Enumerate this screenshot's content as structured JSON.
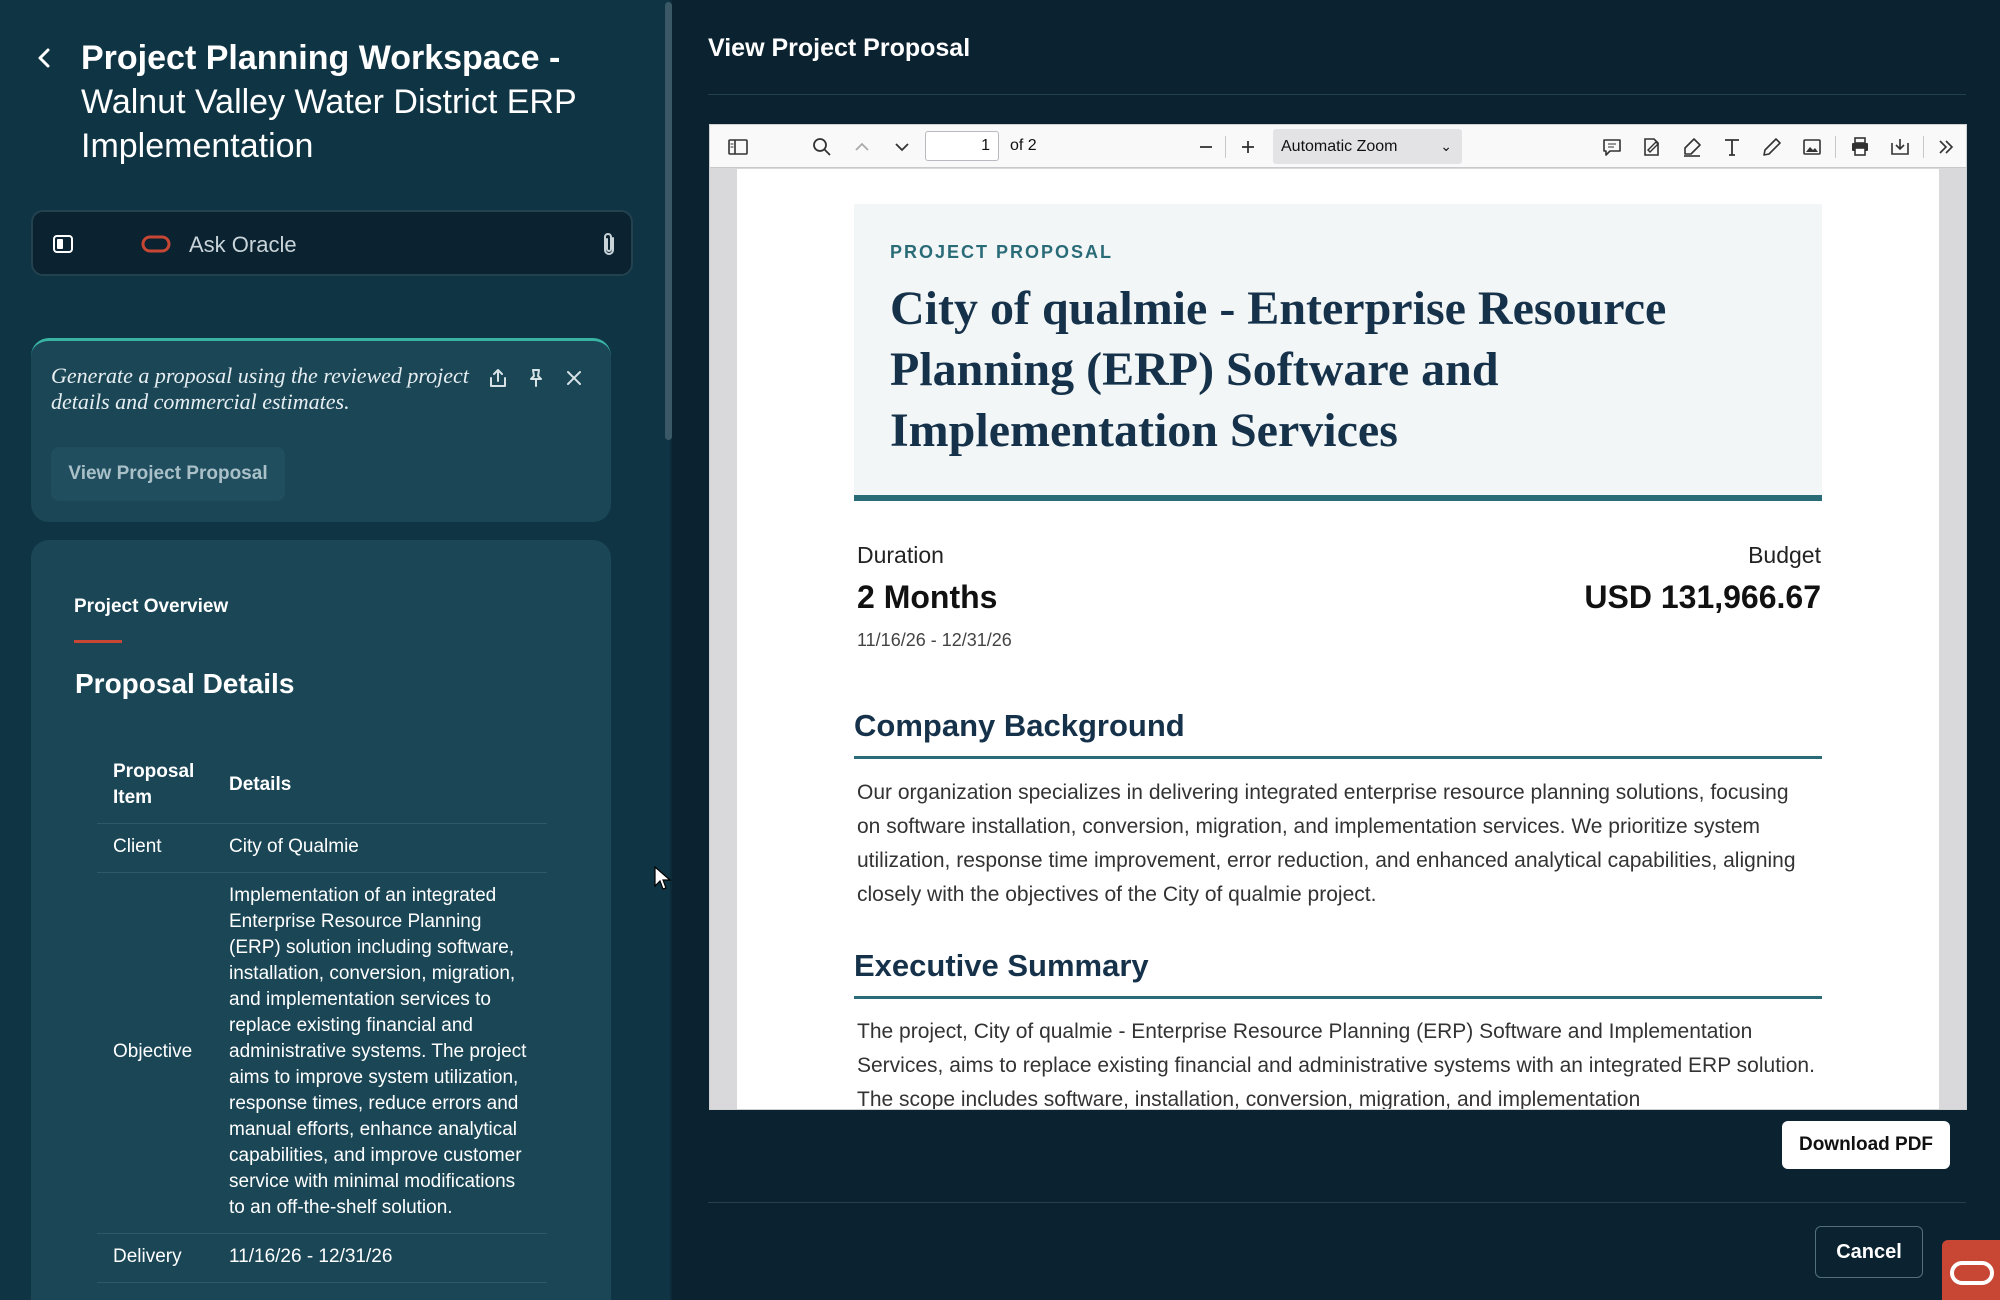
{
  "left_panel": {
    "title_strong": "Project Planning Workspace -",
    "title_rest": "Walnut Valley Water District ERP Implementation",
    "ask": {
      "placeholder": "Ask Oracle"
    },
    "prompt_card": {
      "text": "Generate a proposal using the reviewed project details and commercial estimates.",
      "button_label": "View Project Proposal"
    },
    "overview": {
      "tab_label": "Project Overview",
      "heading": "Proposal Details",
      "table": {
        "headers": [
          "Proposal Item",
          "Details"
        ],
        "rows": [
          {
            "item": "Client",
            "details": "City of Qualmie"
          },
          {
            "item": "Objective",
            "details": "Implementation of an integrated Enterprise Resource Planning (ERP) solution including software, installation, conversion, migration, and implementation services to replace existing financial and administrative systems. The project aims to improve system utilization, response times, reduce errors and manual efforts, enhance analytical capabilities, and improve customer service with minimal modifications to an off-the-shelf solution."
          },
          {
            "item": "Delivery",
            "details": "11/16/26 - 12/31/26"
          }
        ]
      }
    }
  },
  "modal": {
    "title": "View Project Proposal",
    "download_label": "Download PDF",
    "cancel_label": "Cancel"
  },
  "pdf_toolbar": {
    "page_number": "1",
    "page_total": "of 2",
    "zoom": "Automatic Zoom"
  },
  "document": {
    "kicker": "PROJECT PROPOSAL",
    "title": "City of qualmie - Enterprise Resource Planning (ERP) Software and Implementation Services",
    "duration_label": "Duration",
    "duration_value": "2 Months",
    "dates": "11/16/26 - 12/31/26",
    "budget_label": "Budget",
    "budget_value": "USD 131,966.67",
    "sections": [
      {
        "heading": "Company Background",
        "body": "Our organization specializes in delivering integrated enterprise resource planning solutions, focusing on software installation, conversion, migration, and implementation services. We prioritize system utilization, response time improvement, error reduction, and enhanced analytical capabilities, aligning closely with the objectives of the City of qualmie project."
      },
      {
        "heading": "Executive Summary",
        "body": "The project, City of qualmie - Enterprise Resource Planning (ERP) Software and Implementation Services, aims to replace existing financial and administrative systems with an integrated ERP solution. The scope includes software, installation, conversion, migration, and implementation"
      }
    ]
  },
  "colors": {
    "sidebar_bg": "#0f3545",
    "modal_bg": "#0b2230",
    "accent_teal": "#39b4a4",
    "oracle_red": "#c74634",
    "doc_heading": "#16324a"
  }
}
